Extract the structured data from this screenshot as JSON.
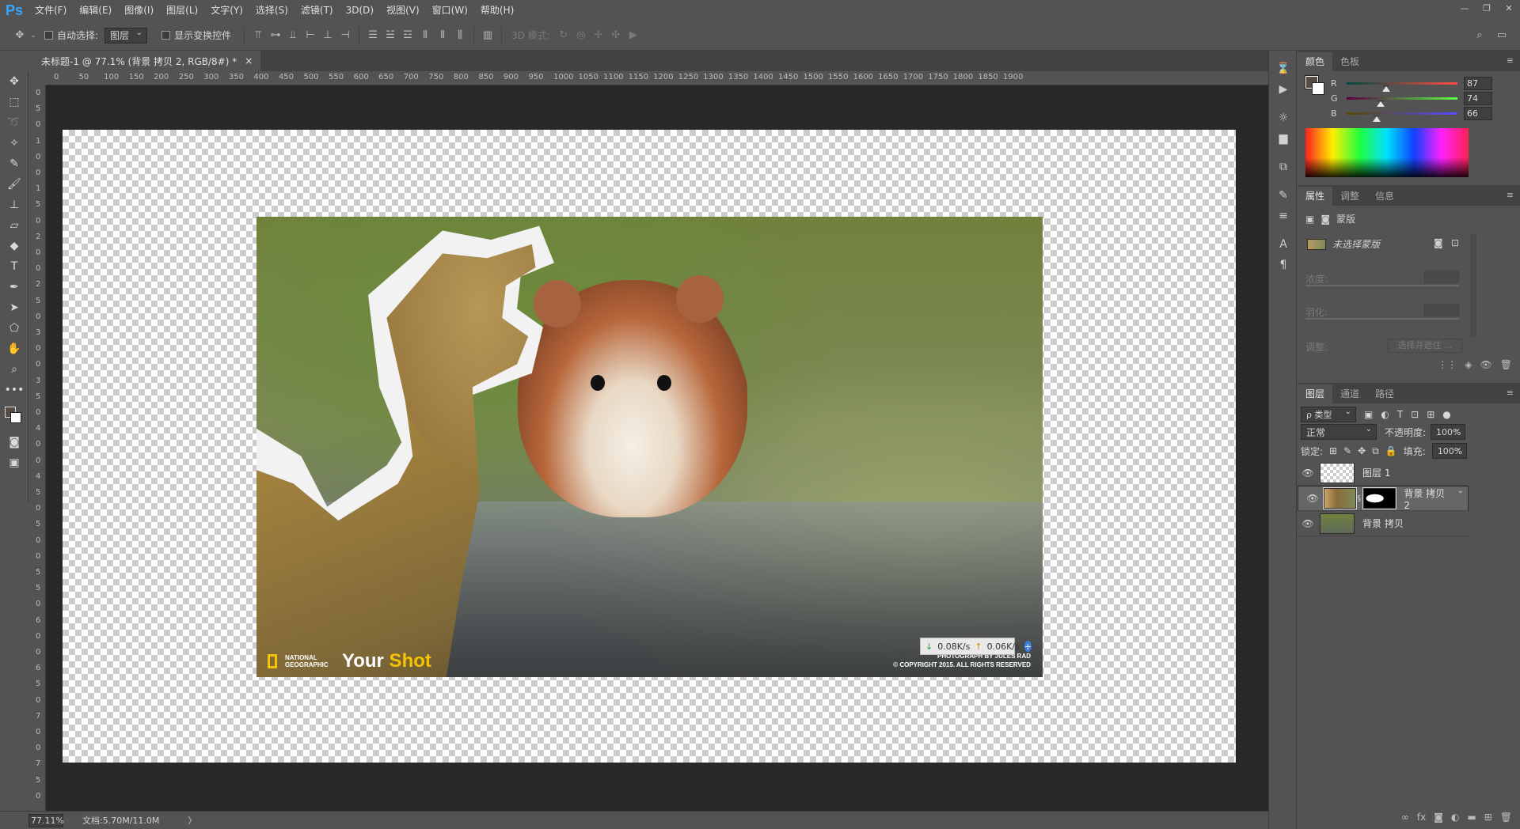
{
  "app": {
    "logo": "Ps"
  },
  "menu": [
    "文件(F)",
    "编辑(E)",
    "图像(I)",
    "图层(L)",
    "文字(Y)",
    "选择(S)",
    "滤镜(T)",
    "3D(D)",
    "视图(V)",
    "窗口(W)",
    "帮助(H)"
  ],
  "options": {
    "auto_select_label": "自动选择:",
    "auto_select_value": "图层",
    "show_transform_label": "显示变换控件",
    "mode_3d_label": "3D 模式:"
  },
  "document": {
    "tab_title": "未标题-1 @ 77.1% (背景 拷贝 2, RGB/8#) *",
    "close_symbol": "×"
  },
  "ruler": {
    "h_ticks": [
      "0",
      "50",
      "100",
      "150",
      "200",
      "250",
      "300",
      "350",
      "400",
      "450",
      "500",
      "550",
      "600",
      "650",
      "700",
      "750",
      "800",
      "850",
      "900",
      "950",
      "1000",
      "1050",
      "1100",
      "1150",
      "1200",
      "1250",
      "1300",
      "1350",
      "1400",
      "1450",
      "1500",
      "1550",
      "1600",
      "1650",
      "1700",
      "1750",
      "1800",
      "1850",
      "1900"
    ],
    "v_ticks": [
      "0",
      "5",
      "0",
      "1",
      "0",
      "0",
      "1",
      "5",
      "0",
      "2",
      "0",
      "0",
      "2",
      "5",
      "0",
      "3",
      "0",
      "0",
      "3",
      "5",
      "0",
      "4",
      "0",
      "0",
      "4",
      "5",
      "0",
      "5",
      "0",
      "0",
      "5",
      "5",
      "0",
      "6",
      "0",
      "0",
      "6",
      "5",
      "0",
      "7",
      "0",
      "0",
      "7",
      "5",
      "0"
    ]
  },
  "image": {
    "brand_line1": "NATIONAL",
    "brand_line2": "GEOGRAPHIC",
    "yourshot_your": "Your",
    "yourshot_shot": " Shot",
    "credit_line1": "PHOTOGRAPH BY JULES RAD",
    "credit_line2": "© COPYRIGHT 2015. ALL RIGHTS RESERVED"
  },
  "net": {
    "down": "0.08K/s",
    "up": "0.06K/s",
    "plus": "+"
  },
  "status": {
    "zoom": "77.11%",
    "doc": "文档:5.70M/11.0M",
    "arrow": "〉"
  },
  "color_panel": {
    "tabs": [
      "颜色",
      "色板"
    ],
    "r": {
      "label": "R",
      "value": "87",
      "pos": 0.34
    },
    "g": {
      "label": "G",
      "value": "74",
      "pos": 0.29
    },
    "b": {
      "label": "B",
      "value": "66",
      "pos": 0.26
    },
    "fg_color": "#574a42",
    "bg_color": "#ffffff"
  },
  "properties_panel": {
    "tabs": [
      "属性",
      "调整",
      "信息"
    ],
    "mask_label": "蒙版",
    "selected_mask_label": "未选择蒙版",
    "density_label": "浓度:",
    "feather_label": "羽化:",
    "adjust_label": "调整:",
    "select_mask_btn": "选择并遮住 ..."
  },
  "layers_panel": {
    "tabs": [
      "图层",
      "通道",
      "路径"
    ],
    "filter_kind": "ρ 类型",
    "blend_mode": "正常",
    "opacity_label": "不透明度:",
    "opacity_value": "100%",
    "lock_label": "锁定:",
    "fill_label": "填充:",
    "fill_value": "100%",
    "layers": [
      {
        "name": "图层 1"
      },
      {
        "name": "背景 拷贝 2"
      },
      {
        "name": "背景 拷贝"
      }
    ]
  },
  "icons": [
    "move-icon",
    "marquee-icon",
    "lasso-icon",
    "magic-wand-icon",
    "eyedropper-icon",
    "brush-icon",
    "stamp-icon",
    "eraser-icon",
    "paint-bucket-icon",
    "type-icon",
    "pen-icon",
    "path-select-icon",
    "shape-icon",
    "hand-icon",
    "zoom-icon",
    "more-icon",
    "search-icon",
    "eye-icon"
  ]
}
